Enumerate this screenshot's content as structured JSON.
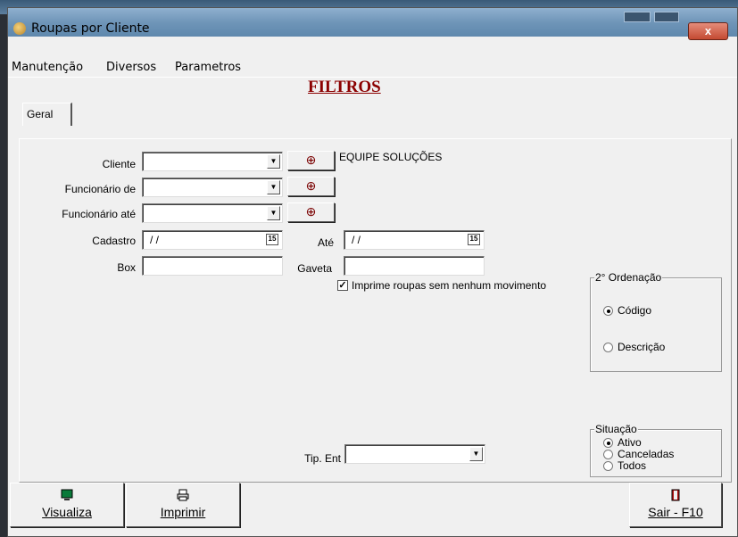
{
  "window": {
    "title": "Roupas por Cliente",
    "close_label": "x"
  },
  "menu": [
    {
      "label": "Manutenção"
    },
    {
      "label": "Diversos"
    },
    {
      "label": "Parametros"
    }
  ],
  "heading": "FILTROS",
  "tab": {
    "label": "Geral"
  },
  "form": {
    "cliente": {
      "label": "Cliente",
      "value": "",
      "info": "EQUIPE SOLUÇÕES"
    },
    "funcionario_de": {
      "label": "Funcionário de",
      "value": ""
    },
    "funcionario_ate": {
      "label": "Funcionário até",
      "value": ""
    },
    "cadastro": {
      "label": "Cadastro",
      "value": "/ /",
      "calendar": "15"
    },
    "ate": {
      "label": "Até",
      "value": "/ /",
      "calendar": "15"
    },
    "box": {
      "label": "Box",
      "value": ""
    },
    "gaveta": {
      "label": "Gaveta",
      "value": ""
    },
    "imprime": {
      "label": "Imprime roupas sem nenhum movimento",
      "checked": true,
      "mark": "✓"
    },
    "tip_ent": {
      "label": "Tip. Ent",
      "value": ""
    }
  },
  "ordenacao": {
    "title": "2° Ordenação",
    "options": [
      {
        "label": "Código",
        "selected": true
      },
      {
        "label": "Descrição",
        "selected": false
      }
    ]
  },
  "situacao": {
    "title": "Situação",
    "options": [
      {
        "label": "Ativo",
        "selected": true
      },
      {
        "label": "Canceladas",
        "selected": false
      },
      {
        "label": "Todos",
        "selected": false
      }
    ]
  },
  "buttons": {
    "visualiza": {
      "label": "Visualiza",
      "icon": "monitor-icon"
    },
    "imprimir": {
      "label": "Imprimir",
      "icon": "printer-icon"
    },
    "sair": {
      "label": "Sair - F10",
      "icon": "exit-door-icon"
    }
  },
  "icons": {
    "search": "magnifier-plus-icon",
    "dropdown": "▼"
  },
  "colors": {
    "heading": "#8b0000",
    "title_bar": "#6f95b8",
    "close_button": "#c44a32"
  }
}
